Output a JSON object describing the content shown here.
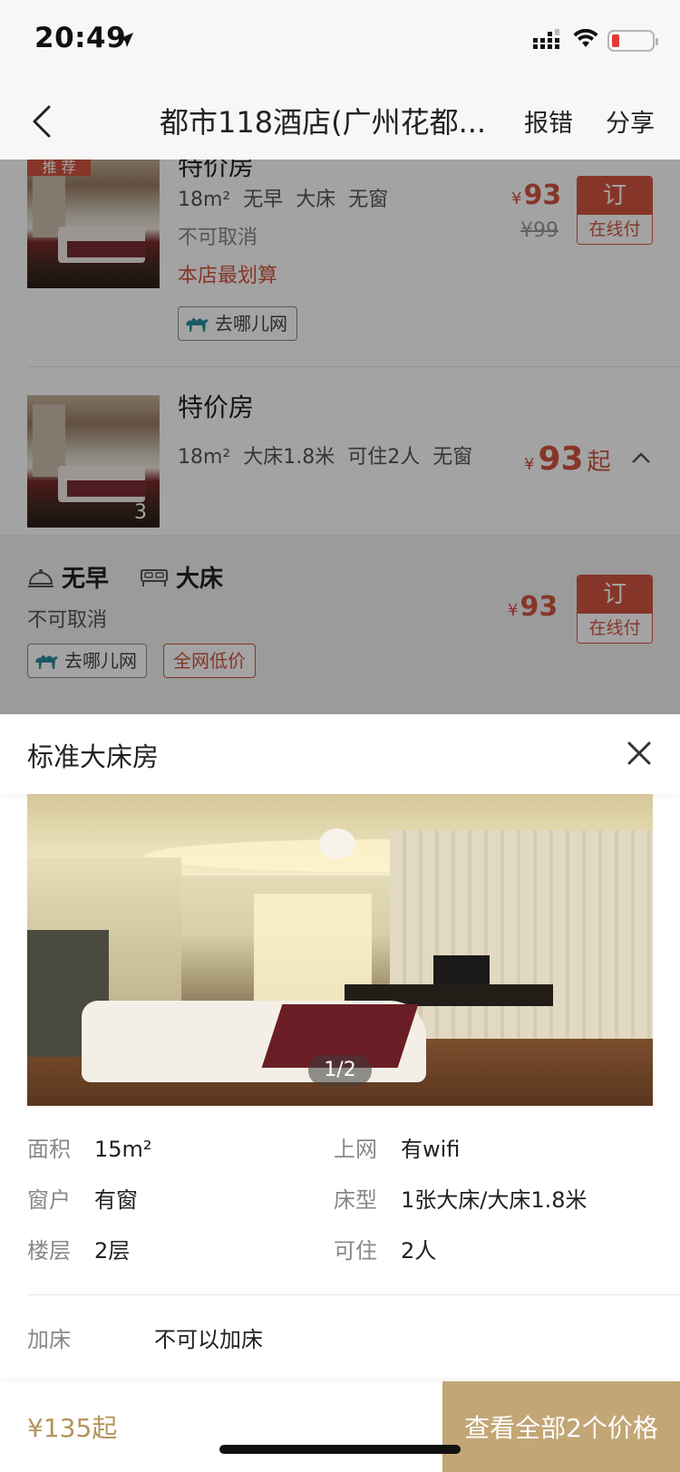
{
  "status": {
    "time": "20:49"
  },
  "nav": {
    "title": "都市118酒店(广州花都...",
    "report": "报错",
    "share": "分享"
  },
  "rooms": {
    "first": {
      "recommend_tag": "推 荐",
      "name_cut": "特价房",
      "specs": [
        "18m²",
        "无早",
        "大床",
        "无窗"
      ],
      "cancel": "不可取消",
      "best_value": "本店最划算",
      "source": "去哪儿网",
      "currency": "¥",
      "price": "93",
      "orig_price": "¥99",
      "book": "订",
      "pay": "在线付"
    },
    "second": {
      "name": "特价房",
      "specs": [
        "18m²",
        "大床1.8米",
        "可住2人",
        "无窗"
      ],
      "photo_count": "3",
      "currency": "¥",
      "from_price": "93",
      "from_suffix": "起"
    },
    "option": {
      "breakfast": "无早",
      "bed": "大床",
      "cancel": "不可取消",
      "source": "去哪儿网",
      "lowest": "全网低价",
      "currency": "¥",
      "price": "93",
      "book": "订",
      "pay": "在线付"
    }
  },
  "sheet": {
    "title": "标准大床房",
    "photo_counter": "1/2",
    "info": [
      {
        "label": "面积",
        "value": "15m²"
      },
      {
        "label": "上网",
        "value": "有wifi"
      },
      {
        "label": "窗户",
        "value": "有窗"
      },
      {
        "label": "床型",
        "value": "1张大床/大床1.8米"
      },
      {
        "label": "楼层",
        "value": "2层"
      },
      {
        "label": "可住",
        "value": "2人"
      }
    ],
    "extra_bed_label": "加床",
    "extra_bed_value": "不可以加床"
  },
  "bottom": {
    "price": "¥135起",
    "view_all": "查看全部2个价格"
  },
  "colors": {
    "accent_red": "#d2553f",
    "gold": "#c2a676",
    "gold_text": "#b5935b"
  }
}
